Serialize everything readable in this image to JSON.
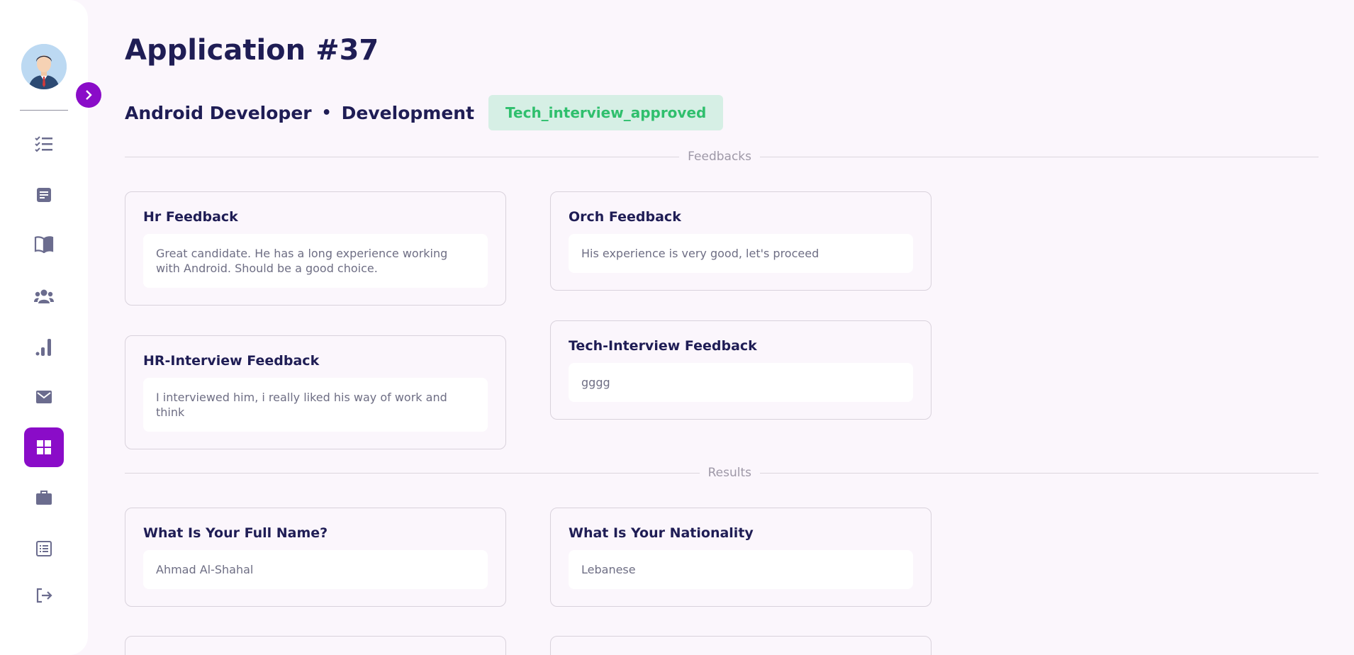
{
  "page": {
    "title": "Application #37",
    "position": "Android Developer",
    "separator": "•",
    "department": "Development",
    "status": "Tech_interview_approved"
  },
  "sections": {
    "feedbacks_label": "Feedbacks",
    "results_label": "Results"
  },
  "feedbacks": [
    {
      "title": "Hr Feedback",
      "value": "Great candidate. He has a long experience working with Android. Should be a good choice."
    },
    {
      "title": "Orch Feedback",
      "value": "His experience is very good, let's proceed"
    },
    {
      "title": "HR-Interview Feedback",
      "value": "I interviewed him, i really liked his way of work and think"
    },
    {
      "title": "Tech-Interview Feedback",
      "value": "gggg"
    }
  ],
  "results": [
    {
      "title": "What Is Your Full Name?",
      "value": "Ahmad Al-Shahal"
    },
    {
      "title": "What Is Your Nationality",
      "value": "Lebanese"
    }
  ],
  "sidebar": {
    "items": [
      {
        "icon": "checklist-icon"
      },
      {
        "icon": "document-icon"
      },
      {
        "icon": "book-icon"
      },
      {
        "icon": "team-icon"
      },
      {
        "icon": "analytics-icon"
      },
      {
        "icon": "mail-icon"
      },
      {
        "icon": "dashboard-icon",
        "active": true
      },
      {
        "icon": "briefcase-icon"
      },
      {
        "icon": "list-icon"
      },
      {
        "icon": "logout-icon"
      }
    ]
  },
  "colors": {
    "accent": "#8a0cc8",
    "status_bg": "#d6efe5",
    "status_text": "#2fbf6d",
    "title": "#1f1d55",
    "background": "#fbf6fc"
  }
}
